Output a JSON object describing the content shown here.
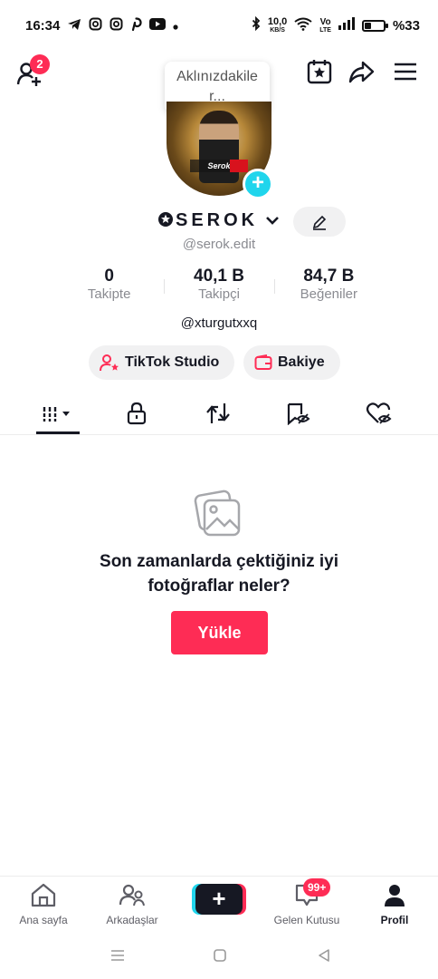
{
  "status_bar": {
    "time": "16:34",
    "network_speed": "10,0",
    "network_unit": "KB/S",
    "volte_top": "Vo",
    "volte_bottom": "LTE",
    "battery": "%33",
    "battery_level": 0.33
  },
  "header": {
    "add_friend_badge": "2",
    "tooltip": "Aklınızdakile\nr..."
  },
  "profile": {
    "avatar_banner": "Serok",
    "display_name": "SEROK",
    "display_prefix_icon": "star-circle-icon",
    "handle": "@serok.edit",
    "stats": [
      {
        "value": "0",
        "label": "Takipte"
      },
      {
        "value": "40,1 B",
        "label": "Takipçi"
      },
      {
        "value": "84,7 B",
        "label": "Beğeniler"
      }
    ],
    "bio": "@xturgutxxq",
    "studio_button": "TikTok Studio",
    "balance_button": "Bakiye"
  },
  "tabs": [
    {
      "icon": "grid-icon",
      "active": true
    },
    {
      "icon": "lock-icon",
      "active": false
    },
    {
      "icon": "repost-icon",
      "active": false
    },
    {
      "icon": "favorites-icon",
      "active": false
    },
    {
      "icon": "liked-icon",
      "active": false
    }
  ],
  "empty_state": {
    "message": "Son zamanlarda çektiğiniz iyi fotoğraflar neler?",
    "upload_button": "Yükle"
  },
  "bottom_nav": {
    "home": "Ana sayfa",
    "friends": "Arkadaşlar",
    "create": "+",
    "inbox": "Gelen Kutusu",
    "inbox_badge": "99+",
    "profile": "Profil"
  },
  "colors": {
    "accent_red": "#fe2c55",
    "accent_cyan": "#20d5ec",
    "text_primary": "#161823",
    "text_secondary": "#8a8b91"
  }
}
